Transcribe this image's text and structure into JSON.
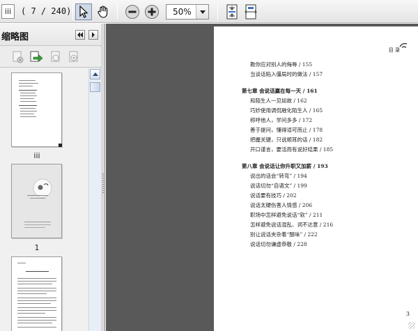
{
  "toolbar": {
    "page_label_box": "iii",
    "page_current": "7",
    "page_total": "240",
    "zoom_value": "50%"
  },
  "panel": {
    "title": "缩略图",
    "thumbnails": [
      {
        "label": "iii"
      },
      {
        "label": "1"
      },
      {
        "label": ""
      }
    ]
  },
  "document": {
    "header": "目 录",
    "page_number": "3",
    "toc": [
      {
        "text": "教你应对别人的侮辱 / 155",
        "chapter": false
      },
      {
        "text": "当谈话陷入僵局时的做法 / 157",
        "chapter": false
      },
      {
        "text": "第七章   会说话赢在每一天 / 161",
        "chapter": true
      },
      {
        "text": "和陌生人一见如故 / 162",
        "chapter": false
      },
      {
        "text": "巧妙使用调侃融化陌生人 / 165",
        "chapter": false
      },
      {
        "text": "称呼他人，学问多多 / 172",
        "chapter": false
      },
      {
        "text": "善于提问，懂得适可而止 / 178",
        "chapter": false
      },
      {
        "text": "把握关键，只说顺耳的话 / 182",
        "chapter": false
      },
      {
        "text": "开口谨言，要活而有说好结果 / 185",
        "chapter": false
      },
      {
        "text": "第八章   会说话让你升职又加薪 / 193",
        "chapter": true
      },
      {
        "text": "说出的话会“转弯” / 194",
        "chapter": false
      },
      {
        "text": "说话切勿“自语文” / 199",
        "chapter": false
      },
      {
        "text": "说话要有技巧 / 202",
        "chapter": false
      },
      {
        "text": "说话太硬伤害人情感 / 206",
        "chapter": false
      },
      {
        "text": "职场中怎样避免说话“软” / 211",
        "chapter": false
      },
      {
        "text": "怎样避免说话混乱、词不达意 / 216",
        "chapter": false
      },
      {
        "text": "别让说话夹杂着“酸味” / 222",
        "chapter": false
      },
      {
        "text": "说话切勿谦虚恭敬 / 228",
        "chapter": false
      }
    ]
  }
}
